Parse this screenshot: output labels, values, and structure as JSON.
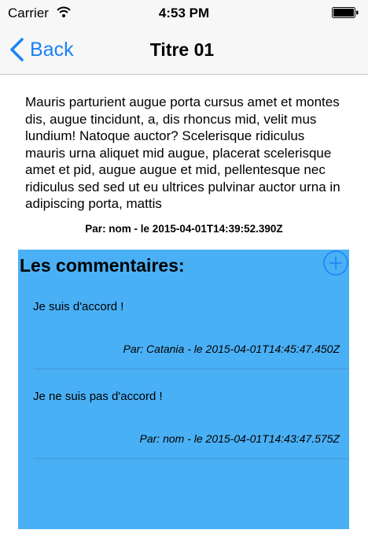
{
  "status_bar": {
    "carrier": "Carrier",
    "time": "4:53 PM"
  },
  "nav": {
    "back_label": "Back",
    "title": "Titre 01"
  },
  "post": {
    "body": "Mauris parturient augue porta cursus amet et montes dis, augue tincidunt, a, dis rhoncus mid, velit mus lundium! Natoque auctor? Scelerisque ridiculus mauris urna aliquet mid augue, placerat scelerisque amet et pid, augue augue et mid, pellentesque nec ridiculus sed sed ut eu ultrices pulvinar auctor urna in adipiscing porta, mattis",
    "meta": "Par: nom - le 2015-04-01T14:39:52.390Z"
  },
  "comments": {
    "title": "Les commentaires:",
    "items": [
      {
        "text": "Je suis d'accord !",
        "meta": "Par: Catania - le 2015-04-01T14:45:47.450Z"
      },
      {
        "text": "Je ne suis pas d'accord !",
        "meta": "Par: nom - le 2015-04-01T14:43:47.575Z"
      }
    ]
  },
  "colors": {
    "accent": "#1a82f7",
    "comments_background": "#4ab0f5"
  },
  "icons": {
    "signal": "wifi-icon",
    "battery": "battery-icon",
    "back": "chevron-left-icon",
    "add": "plus-circle-icon"
  }
}
